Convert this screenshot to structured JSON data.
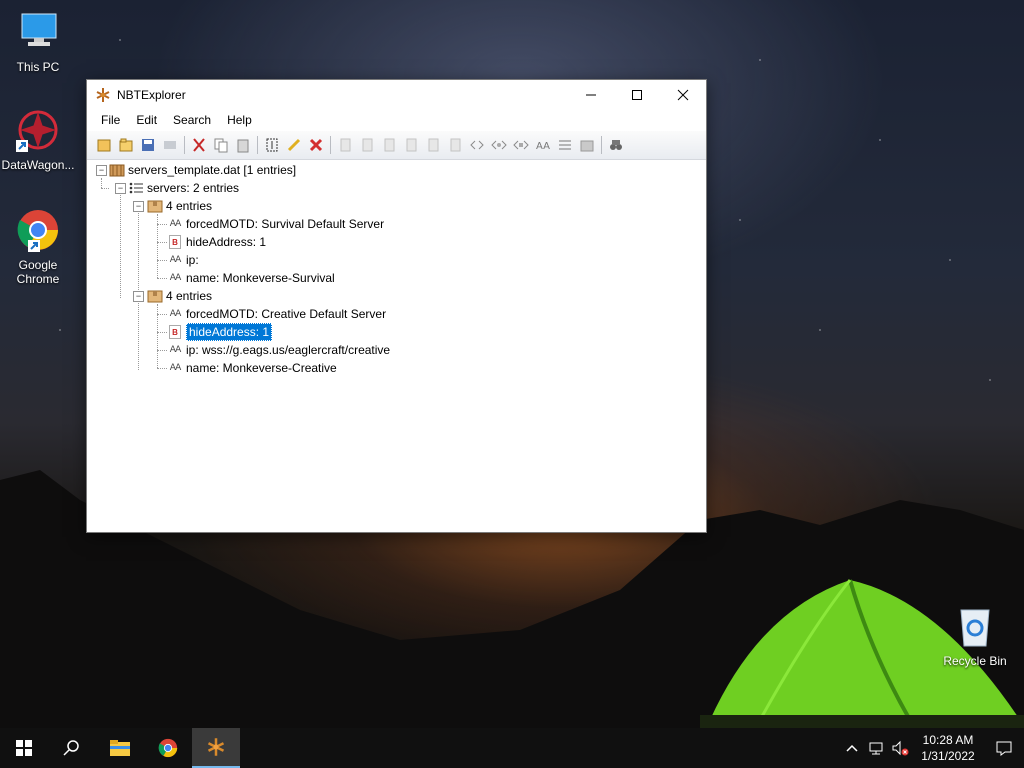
{
  "desktop": {
    "icons": [
      {
        "label": "This PC"
      },
      {
        "label": "DataWagon..."
      },
      {
        "label_line1": "Google",
        "label_line2": "Chrome"
      },
      {
        "label": "Recycle Bin"
      }
    ]
  },
  "window": {
    "title": "NBTExplorer",
    "menu": [
      "File",
      "Edit",
      "Search",
      "Help"
    ],
    "toolbar_icons": [
      "open-icon",
      "open-folder-icon",
      "save-icon",
      "refresh-icon",
      "cut-icon",
      "copy-icon",
      "paste-icon",
      "rename-icon",
      "edit-icon",
      "delete-icon",
      "add-byte-icon",
      "add-short-icon",
      "add-int-icon",
      "add-long-icon",
      "add-float-icon",
      "add-double-icon",
      "add-byte-array-icon",
      "add-int-array-icon",
      "add-long-array-icon",
      "add-string-icon",
      "add-list-icon",
      "add-compound-icon",
      "find-icon"
    ]
  },
  "tree": {
    "root": "servers_template.dat [1 entries]",
    "servers": "servers: 2 entries",
    "group1": {
      "label": "4 entries",
      "items": [
        {
          "type": "string",
          "text": "forcedMOTD: Survival Default Server"
        },
        {
          "type": "byte",
          "text": "hideAddress: 1"
        },
        {
          "type": "string",
          "text": "ip:"
        },
        {
          "type": "string",
          "text": "name: Monkeverse-Survival"
        }
      ]
    },
    "group2": {
      "label": "4 entries",
      "items": [
        {
          "type": "string",
          "text": "forcedMOTD: Creative Default Server"
        },
        {
          "type": "byte",
          "text": "hideAddress: 1",
          "selected": true
        },
        {
          "type": "string",
          "text": "ip: wss://g.eags.us/eaglercraft/creative"
        },
        {
          "type": "string",
          "text": "name: Monkeverse-Creative"
        }
      ]
    },
    "string_glyph": "AA",
    "byte_glyph": "B"
  },
  "taskbar": {
    "clock_time": "10:28 AM",
    "clock_date": "1/31/2022"
  },
  "colors": {
    "selection": "#0078d7",
    "taskbar": "#101010"
  }
}
